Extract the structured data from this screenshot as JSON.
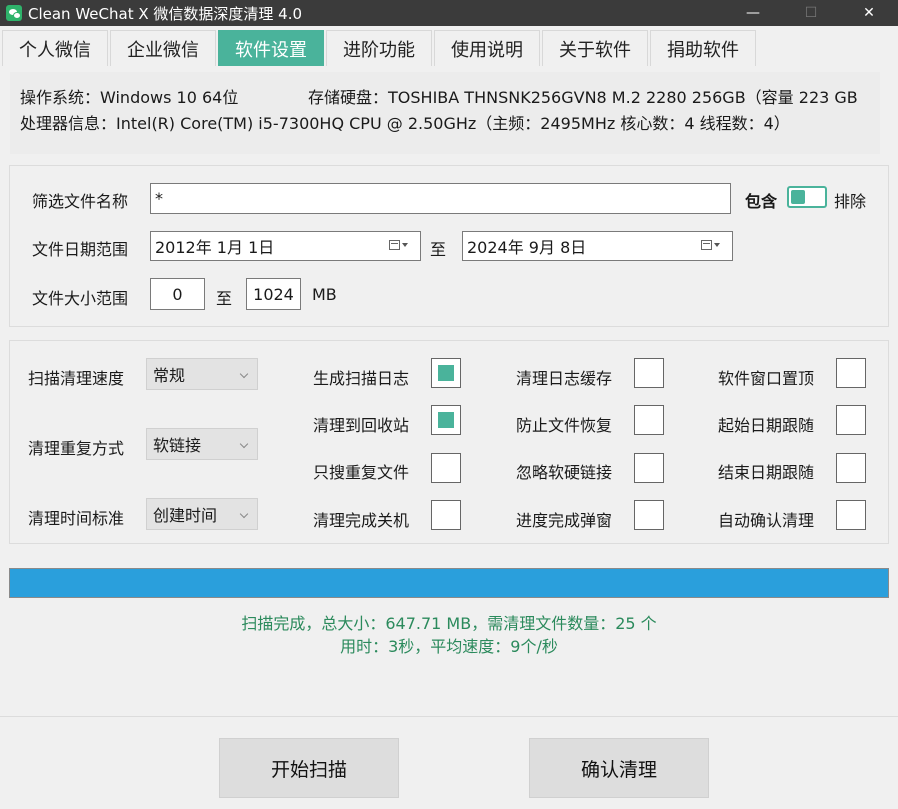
{
  "window": {
    "title": "Clean WeChat X 微信数据深度清理 4.0",
    "minimize": "—",
    "maximize": "☐",
    "close": "✕"
  },
  "tabs": [
    {
      "label": "个人微信",
      "active": false
    },
    {
      "label": "企业微信",
      "active": false
    },
    {
      "label": "软件设置",
      "active": true
    },
    {
      "label": "进阶功能",
      "active": false
    },
    {
      "label": "使用说明",
      "active": false
    },
    {
      "label": "关于软件",
      "active": false
    },
    {
      "label": "捐助软件",
      "active": false
    }
  ],
  "sysinfo": {
    "os_label": "操作系统：",
    "os_value": "Windows 10 64位",
    "disk_label": "存储硬盘：",
    "disk_value": "TOSHIBA THNSNK256GVN8 M.2 2280 256GB（容量 223 GB",
    "cpu_label": "处理器信息：",
    "cpu_value": "Intel(R) Core(TM) i5-7300HQ CPU @ 2.50GHz（主频：2495MHz   核心数：4   线程数：4）"
  },
  "filter": {
    "name_label": "筛选文件名称",
    "name_value": "*",
    "include_label": "包含",
    "exclude_label": "排除",
    "date_label": "文件日期范围",
    "date_from": "2012年  1月  1日",
    "date_to_label": "至",
    "date_to": "2024年  9月  8日",
    "size_label": "文件大小范围",
    "size_min": "0",
    "size_to_label": "至",
    "size_max": "1024",
    "size_unit": "MB"
  },
  "options": {
    "speed_label": "扫描清理速度",
    "speed_value": "常规",
    "dup_label": "清理重复方式",
    "dup_value": "软链接",
    "time_label": "清理时间标准",
    "time_value": "创建时间",
    "checkboxes": [
      {
        "label": "生成扫描日志",
        "checked": true
      },
      {
        "label": "清理日志缓存",
        "checked": false
      },
      {
        "label": "软件窗口置顶",
        "checked": false
      },
      {
        "label": "清理到回收站",
        "checked": true
      },
      {
        "label": "防止文件恢复",
        "checked": false
      },
      {
        "label": "起始日期跟随",
        "checked": false
      },
      {
        "label": "只搜重复文件",
        "checked": false
      },
      {
        "label": "忽略软硬链接",
        "checked": false
      },
      {
        "label": "结束日期跟随",
        "checked": false
      },
      {
        "label": "清理完成关机",
        "checked": false
      },
      {
        "label": "进度完成弹窗",
        "checked": false
      },
      {
        "label": "自动确认清理",
        "checked": false
      }
    ]
  },
  "progress": {
    "percent": 100
  },
  "status": {
    "line1": "扫描完成，总大小：647.71 MB，需清理文件数量：25 个",
    "line2": "用时：3秒，平均速度：9个/秒"
  },
  "actions": {
    "scan": "开始扫描",
    "clean": "确认清理"
  },
  "colors": {
    "accent": "#4ab39b",
    "progress": "#2a9fdc",
    "status_text": "#2b8a5c",
    "titlebar": "#3b3b3b"
  }
}
